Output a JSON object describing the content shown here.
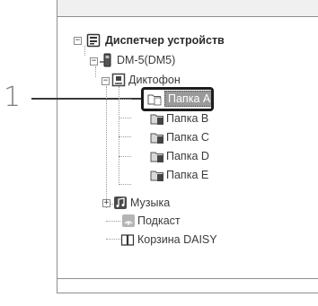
{
  "step_number": "1",
  "tree": {
    "root": {
      "label": "Диспетчер устройств",
      "expander": "−"
    },
    "device": {
      "label": "DM-5(DM5)",
      "expander": "−"
    },
    "recorder": {
      "label": "Диктофон",
      "expander": "−"
    },
    "folders": [
      {
        "label": "Папка A",
        "letter": "A",
        "selected": true
      },
      {
        "label": "Папка B",
        "letter": "B",
        "selected": false
      },
      {
        "label": "Папка C",
        "letter": "C",
        "selected": false
      },
      {
        "label": "Папка D",
        "letter": "D",
        "selected": false
      },
      {
        "label": "Папка E",
        "letter": "E",
        "selected": false
      }
    ],
    "music": {
      "label": "Музыка",
      "expander": "+"
    },
    "podcast": {
      "label": "Подкаст"
    },
    "daisy": {
      "label": "Корзина DAISY"
    }
  },
  "colors": {
    "selection": "#9a9a9a",
    "callout": "#1c1c1c",
    "text": "#3a3a3a"
  }
}
